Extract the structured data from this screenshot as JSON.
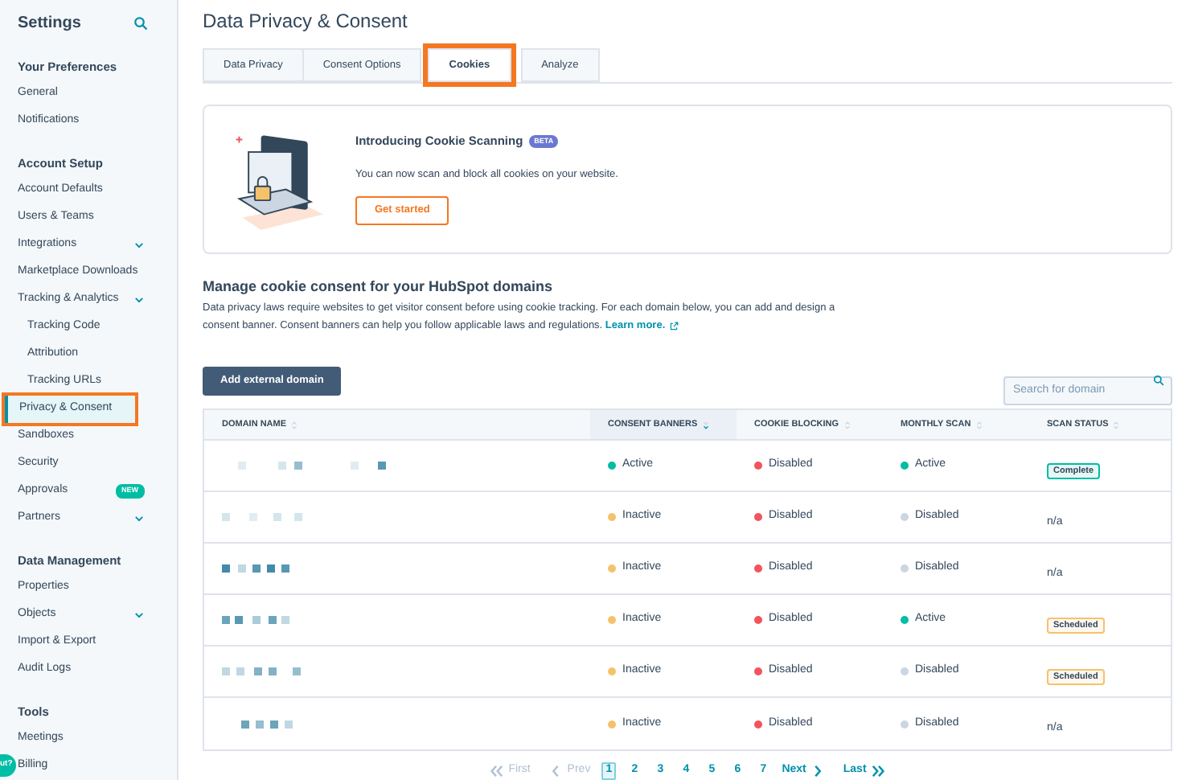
{
  "sidebar": {
    "title": "Settings",
    "sections": [
      {
        "heading": "Your Preferences",
        "items": [
          {
            "label": "General",
            "selected": false
          },
          {
            "label": "Notifications",
            "selected": false
          }
        ]
      },
      {
        "heading": "Account Setup",
        "items": [
          {
            "label": "Account Defaults",
            "selected": false
          },
          {
            "label": "Users & Teams",
            "selected": false
          },
          {
            "label": "Integrations",
            "selected": false,
            "expandable": true
          },
          {
            "label": "Marketplace Downloads",
            "selected": false
          },
          {
            "label": "Tracking & Analytics",
            "selected": false,
            "expandable": true,
            "children": [
              {
                "label": "Tracking Code",
                "selected": false
              },
              {
                "label": "Attribution",
                "selected": false
              },
              {
                "label": "Tracking URLs",
                "selected": false
              }
            ]
          },
          {
            "label": "Privacy & Consent",
            "selected": true
          },
          {
            "label": "Sandboxes",
            "selected": false
          },
          {
            "label": "Security",
            "selected": false
          },
          {
            "label": "Approvals",
            "selected": false,
            "badge": "NEW"
          },
          {
            "label": "Partners",
            "selected": false,
            "expandable": true
          }
        ]
      },
      {
        "heading": "Data Management",
        "items": [
          {
            "label": "Properties",
            "selected": false
          },
          {
            "label": "Objects",
            "selected": false,
            "expandable": true
          },
          {
            "label": "Import & Export",
            "selected": false
          },
          {
            "label": "Audit Logs",
            "selected": false
          }
        ]
      },
      {
        "heading": "Tools",
        "items": [
          {
            "label": "Meetings",
            "selected": false
          },
          {
            "label": "Billing",
            "selected": false
          }
        ]
      }
    ]
  },
  "chat_bubble": {
    "label": "ut?"
  },
  "page_title": "Data Privacy & Consent",
  "tabs": [
    {
      "label": "Data Privacy",
      "selected": false
    },
    {
      "label": "Consent Options",
      "selected": false
    },
    {
      "label": "Cookies",
      "selected": true
    },
    {
      "label": "Analyze",
      "selected": false
    }
  ],
  "promo": {
    "title": "Introducing Cookie Scanning",
    "badge": "BETA",
    "text": "You can now scan and block all cookies on your website.",
    "button": "Get started"
  },
  "section": {
    "heading": "Manage cookie consent for your HubSpot domains",
    "text": "Data privacy laws require websites to get visitor consent before using cookie tracking. For each domain below, you can add and design a consent banner. Consent banners can help you follow applicable laws and regulations.",
    "link": "Learn more."
  },
  "add_button": "Add external domain",
  "search": {
    "placeholder": "Search for domain"
  },
  "table": {
    "columns": [
      {
        "label": "DOMAIN NAME",
        "selected": false
      },
      {
        "label": "CONSENT BANNERS",
        "selected": true
      },
      {
        "label": "COOKIE BLOCKING",
        "selected": false
      },
      {
        "label": "MONTHLY SCAN",
        "selected": false
      },
      {
        "label": "SCAN STATUS",
        "selected": false
      }
    ],
    "rows": [
      {
        "consent": {
          "label": "Active",
          "color": "#00bda5"
        },
        "blocking": {
          "label": "Disabled",
          "color": "#f2545b"
        },
        "scan": {
          "label": "Active",
          "color": "#00bda5"
        },
        "status": {
          "label": "Complete",
          "kind": "success"
        }
      },
      {
        "consent": {
          "label": "Inactive",
          "color": "#f5c26b"
        },
        "blocking": {
          "label": "Disabled",
          "color": "#f2545b"
        },
        "scan": {
          "label": "Disabled",
          "color": "#cbd6e2"
        },
        "status": {
          "label": "n/a",
          "kind": "text"
        }
      },
      {
        "consent": {
          "label": "Inactive",
          "color": "#f5c26b"
        },
        "blocking": {
          "label": "Disabled",
          "color": "#f2545b"
        },
        "scan": {
          "label": "Disabled",
          "color": "#cbd6e2"
        },
        "status": {
          "label": "n/a",
          "kind": "text"
        }
      },
      {
        "consent": {
          "label": "Inactive",
          "color": "#f5c26b"
        },
        "blocking": {
          "label": "Disabled",
          "color": "#f2545b"
        },
        "scan": {
          "label": "Active",
          "color": "#00bda5"
        },
        "status": {
          "label": "Scheduled",
          "kind": "warning"
        }
      },
      {
        "consent": {
          "label": "Inactive",
          "color": "#f5c26b"
        },
        "blocking": {
          "label": "Disabled",
          "color": "#f2545b"
        },
        "scan": {
          "label": "Disabled",
          "color": "#cbd6e2"
        },
        "status": {
          "label": "Scheduled",
          "kind": "warning"
        }
      },
      {
        "consent": {
          "label": "Inactive",
          "color": "#f5c26b"
        },
        "blocking": {
          "label": "Disabled",
          "color": "#f2545b"
        },
        "scan": {
          "label": "Disabled",
          "color": "#cbd6e2"
        },
        "status": {
          "label": "n/a",
          "kind": "text"
        }
      }
    ]
  },
  "pagination": {
    "first": "First",
    "prev": "Prev",
    "pages": [
      {
        "label": "1",
        "selected": true
      },
      {
        "label": "2",
        "selected": false
      },
      {
        "label": "3",
        "selected": false
      },
      {
        "label": "4",
        "selected": false
      },
      {
        "label": "5",
        "selected": false
      },
      {
        "label": "6",
        "selected": false
      },
      {
        "label": "7",
        "selected": false
      }
    ],
    "next": "Next",
    "last": "Last"
  }
}
